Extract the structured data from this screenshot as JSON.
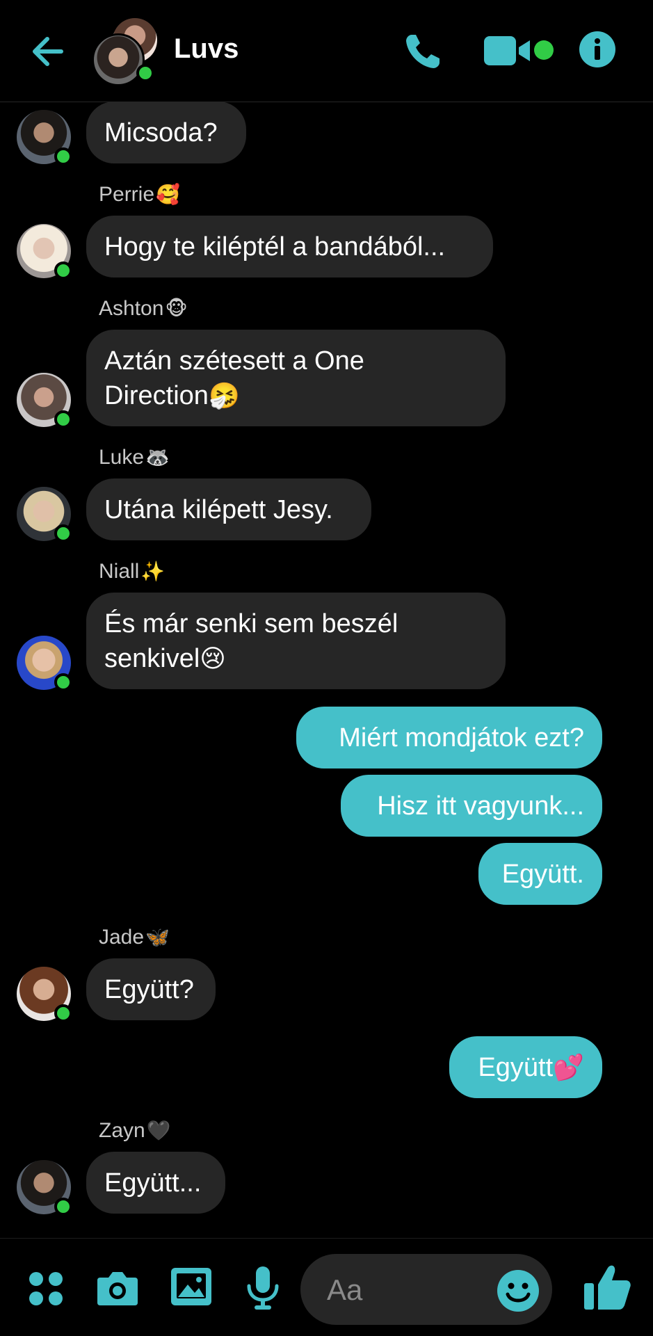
{
  "header": {
    "title": "Luvs",
    "back_icon": "arrow-left-icon",
    "call_icon": "phone-icon",
    "video_icon": "video-camera-icon",
    "info_icon": "info-icon",
    "accent_color": "#45c0c9",
    "online_color": "#31cc46"
  },
  "messages": [
    {
      "direction": "in",
      "sender": "",
      "text": "Micsoda?"
    },
    {
      "direction": "in",
      "sender": "Perrie",
      "sender_emoji": "🥰",
      "text": "Hogy te kiléptél a bandából..."
    },
    {
      "direction": "in",
      "sender": "Ashton",
      "sender_emoji": "🐵",
      "text": "Aztán szétesett a One",
      "text_line2": "Direction",
      "text_emoji": "🤧"
    },
    {
      "direction": "in",
      "sender": "Luke",
      "sender_emoji": "🦝",
      "text": "Utána kilépett Jesy."
    },
    {
      "direction": "in",
      "sender": "Niall",
      "sender_emoji": "✨",
      "text": "És már senki sem beszél",
      "text_line2": "senkivel",
      "text_emoji": "😢"
    },
    {
      "direction": "out",
      "text": "Miért mondjátok ezt?"
    },
    {
      "direction": "out",
      "text": "Hisz itt vagyunk..."
    },
    {
      "direction": "out",
      "text": "Együtt."
    },
    {
      "direction": "in",
      "sender": "Jade",
      "sender_emoji": "🦋",
      "text": "Együtt?"
    },
    {
      "direction": "out",
      "text": "Együtt",
      "text_emoji": "💕"
    },
    {
      "direction": "in",
      "sender": "Zayn",
      "sender_emoji": "🖤",
      "text": "Együtt..."
    }
  ],
  "composer": {
    "menu_icon": "four-dots-icon",
    "camera_icon": "camera-icon",
    "gallery_icon": "image-icon",
    "mic_icon": "microphone-icon",
    "placeholder": "Aa",
    "emoji_icon": "smiley-icon",
    "like_icon": "thumbs-up-icon"
  }
}
